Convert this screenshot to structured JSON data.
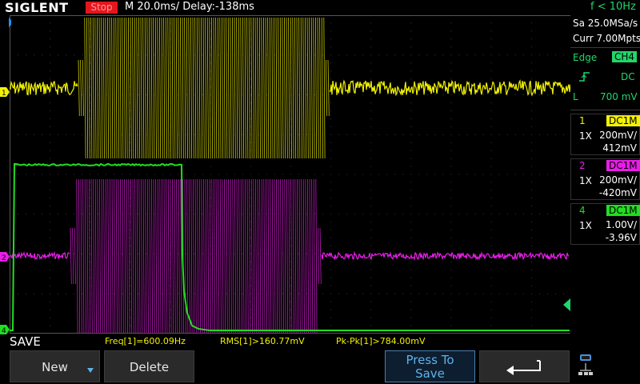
{
  "header": {
    "brand": "SIGLENT",
    "run_state": "Stop",
    "timebase": "M 20.0ms/ Delay:-138ms",
    "freq_counter": "f < 10Hz"
  },
  "acquisition": {
    "sample_rate": "Sa 25.0MSa/s",
    "memory_depth": "Curr 7.00Mpts"
  },
  "trigger": {
    "type": "Edge",
    "source": "CH4",
    "slope_icon": "rising-edge-icon",
    "coupling": "DC",
    "level_prefix": "L",
    "level": "700 mV"
  },
  "channels": [
    {
      "number": "1",
      "coupling": "DC1M",
      "probe": "1X",
      "scale": "200mV/",
      "offset": "412mV",
      "color": "#f2f200",
      "marker": "1"
    },
    {
      "number": "2",
      "coupling": "DC1M",
      "probe": "1X",
      "scale": "200mV/",
      "offset": "-420mV",
      "color": "#e81ee8",
      "marker": "2"
    },
    {
      "number": "4",
      "coupling": "DC1M",
      "probe": "1X",
      "scale": "1.00V/",
      "offset": "-3.96V",
      "color": "#22dd22",
      "marker": "4"
    }
  ],
  "measurements": {
    "freq": "Freq[1]=600.09Hz",
    "rms": "RMS[1]>160.77mV",
    "pkpk": "Pk-Pk[1]>784.00mV"
  },
  "menu": {
    "title": "SAVE",
    "new_label": "New",
    "delete_label": "Delete",
    "press_to_save_line1": "Press To",
    "press_to_save_line2": "Save",
    "back_icon": "return-arrow-icon",
    "status_icon": "network-usb-icon"
  },
  "colors": {
    "ch1": "#f2f200",
    "ch2": "#e81ee8",
    "ch4": "#22dd22",
    "trigger_green": "#21d66a",
    "stop_red": "#e3161d",
    "grid": "#3a3a3a",
    "menu_blue": "#5fb2ea"
  }
}
